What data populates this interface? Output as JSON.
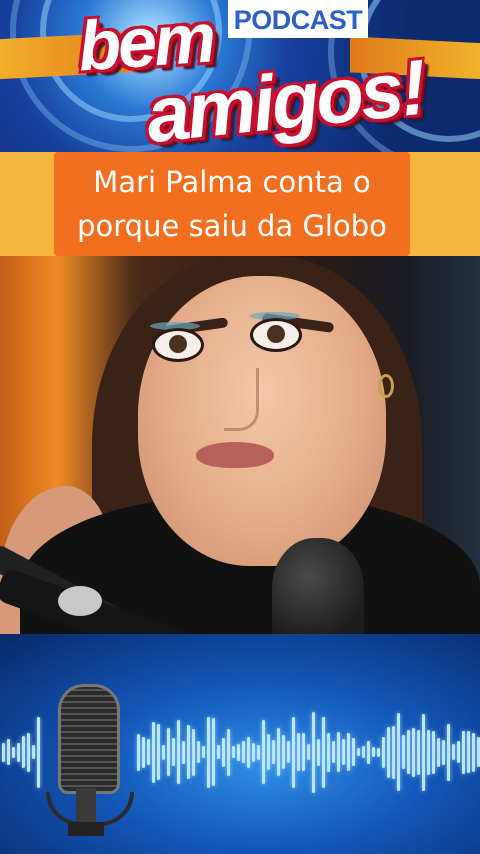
{
  "banner": {
    "podcast_label": "PODCAST",
    "logo_line1": "bem",
    "logo_line2": "amigos!",
    "colors": {
      "logo_text": "#ffffff",
      "logo_outline": "#c8102e",
      "background": "#173f9c",
      "stripe": "#f3b62c"
    }
  },
  "headline": {
    "line1": "Mari Palma conta o",
    "line2": "porque saiu da Globo",
    "colors": {
      "box": "#f26f1f",
      "background": "#f4b63f",
      "text": "#ffffff"
    }
  },
  "photo": {
    "icon": "woman-speaking-into-microphone-photo"
  },
  "footer_graphic": {
    "icon": "studio-microphone-with-audio-waveform",
    "colors": {
      "background": "#1356b8",
      "wave": "#bfe6ff"
    }
  }
}
